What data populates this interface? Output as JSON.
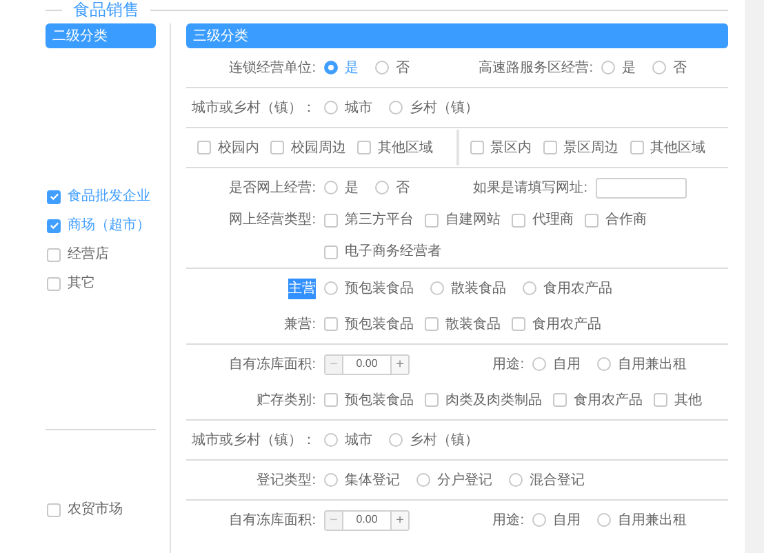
{
  "title": "食品销售",
  "sidebar": {
    "header": "二级分类",
    "groups": [
      {
        "items": [
          {
            "label": "食品批发企业",
            "checked": true
          },
          {
            "label": "商场（超市）",
            "checked": true
          },
          {
            "label": "经营店",
            "checked": false
          },
          {
            "label": "其它",
            "checked": false
          }
        ]
      },
      {
        "items": [
          {
            "label": "农贸市场",
            "checked": false
          }
        ]
      }
    ]
  },
  "panel": {
    "header": "三级分类",
    "sections": [
      {
        "rows": [
          {
            "fields": [
              {
                "kind": "radio",
                "label": "连锁经营单位:",
                "options": [
                  {
                    "label": "是",
                    "selected": true
                  },
                  {
                    "label": "否",
                    "selected": false
                  }
                ]
              },
              {
                "kind": "radio",
                "label": "高速路服务区经营:",
                "options": [
                  {
                    "label": "是",
                    "selected": false
                  },
                  {
                    "label": "否",
                    "selected": false
                  }
                ]
              }
            ]
          }
        ]
      },
      {
        "rows": [
          {
            "fields": [
              {
                "kind": "radio",
                "label": "城市或乡村（镇）：",
                "options": [
                  {
                    "label": "城市",
                    "selected": false
                  },
                  {
                    "label": "乡村（镇）",
                    "selected": false
                  }
                ]
              }
            ]
          }
        ]
      },
      {
        "rows": [
          {
            "split": true,
            "fields": [
              {
                "kind": "checkbox",
                "options": [
                  {
                    "label": "校园内",
                    "checked": false
                  },
                  {
                    "label": "校园周边",
                    "checked": false
                  },
                  {
                    "label": "其他区域",
                    "checked": false
                  }
                ]
              },
              {
                "kind": "checkbox",
                "options": [
                  {
                    "label": "景区内",
                    "checked": false
                  },
                  {
                    "label": "景区周边",
                    "checked": false
                  },
                  {
                    "label": "其他区域",
                    "checked": false
                  }
                ]
              }
            ]
          }
        ]
      },
      {
        "rows": [
          {
            "fields": [
              {
                "kind": "radio",
                "label": "是否网上经营:",
                "options": [
                  {
                    "label": "是",
                    "selected": false
                  },
                  {
                    "label": "否",
                    "selected": false
                  }
                ]
              },
              {
                "kind": "input",
                "label": "如果是请填写网址:"
              }
            ]
          },
          {
            "fields": [
              {
                "kind": "checkbox",
                "label": "网上经营类型:",
                "options": [
                  {
                    "label": "第三方平台",
                    "checked": false
                  },
                  {
                    "label": "自建网站",
                    "checked": false
                  },
                  {
                    "label": "代理商",
                    "checked": false
                  },
                  {
                    "label": "合作商",
                    "checked": false
                  },
                  {
                    "label": "电子商务经营者",
                    "checked": false
                  }
                ]
              }
            ]
          }
        ]
      },
      {
        "rows": [
          {
            "fields": [
              {
                "kind": "radio",
                "label": "主营",
                "highlighted": true,
                "options": [
                  {
                    "label": "预包装食品",
                    "selected": false
                  },
                  {
                    "label": "散装食品",
                    "selected": false
                  },
                  {
                    "label": "食用农产品",
                    "selected": false
                  }
                ]
              }
            ]
          },
          {
            "fields": [
              {
                "kind": "checkbox",
                "label": "兼营:",
                "highlighted": false,
                "options": [
                  {
                    "label": "预包装食品",
                    "checked": false
                  },
                  {
                    "label": "散装食品",
                    "checked": false
                  },
                  {
                    "label": "食用农产品",
                    "checked": false
                  }
                ]
              }
            ]
          }
        ]
      },
      {
        "rows": [
          {
            "fields": [
              {
                "kind": "number",
                "label": "自有冻库面积:",
                "minus": "−",
                "value": "0.00",
                "plus": "+"
              },
              {
                "kind": "radio",
                "label": "用途:",
                "options": [
                  {
                    "label": "自用",
                    "selected": false
                  },
                  {
                    "label": "自用兼出租",
                    "selected": false
                  }
                ]
              }
            ]
          },
          {
            "fields": [
              {
                "kind": "checkbox",
                "label": "贮存类别:",
                "options": [
                  {
                    "label": "预包装食品",
                    "checked": false
                  },
                  {
                    "label": "肉类及肉类制品",
                    "checked": false
                  },
                  {
                    "label": "食用农产品",
                    "checked": false
                  },
                  {
                    "label": "其他",
                    "checked": false
                  }
                ]
              }
            ]
          }
        ]
      },
      {
        "rows": [
          {
            "fields": [
              {
                "kind": "radio",
                "label": "城市或乡村（镇）：",
                "options": [
                  {
                    "label": "城市",
                    "selected": false
                  },
                  {
                    "label": "乡村（镇）",
                    "selected": false
                  }
                ]
              }
            ]
          }
        ]
      },
      {
        "rows": [
          {
            "fields": [
              {
                "kind": "radio",
                "label": "登记类型:",
                "options": [
                  {
                    "label": "集体登记",
                    "selected": false
                  },
                  {
                    "label": "分户登记",
                    "selected": false
                  },
                  {
                    "label": "混合登记",
                    "selected": false
                  }
                ]
              }
            ]
          }
        ]
      },
      {
        "rows": [
          {
            "fields": [
              {
                "kind": "number",
                "label": "自有冻库面积:",
                "minus": "−",
                "value": "0.00",
                "plus": "+"
              },
              {
                "kind": "radio",
                "label": "用途:",
                "options": [
                  {
                    "label": "自用",
                    "selected": false
                  },
                  {
                    "label": "自用兼出租",
                    "selected": false
                  }
                ]
              }
            ]
          }
        ]
      }
    ]
  }
}
